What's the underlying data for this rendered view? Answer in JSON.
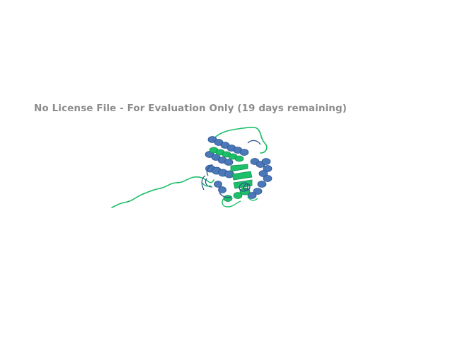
{
  "viewer": {
    "watermark_text": "No License File - For Evaluation Only (19 days remaining)"
  },
  "structure": {
    "icon": "protein-cartoon-icon",
    "colors": {
      "chain_a": "#4a78b8",
      "chain_a_dark": "#2f5590",
      "chain_b": "#1dbf6a",
      "chain_b_dark": "#12934f",
      "background": "#ffffff",
      "watermark": "#8c8c8c"
    }
  }
}
